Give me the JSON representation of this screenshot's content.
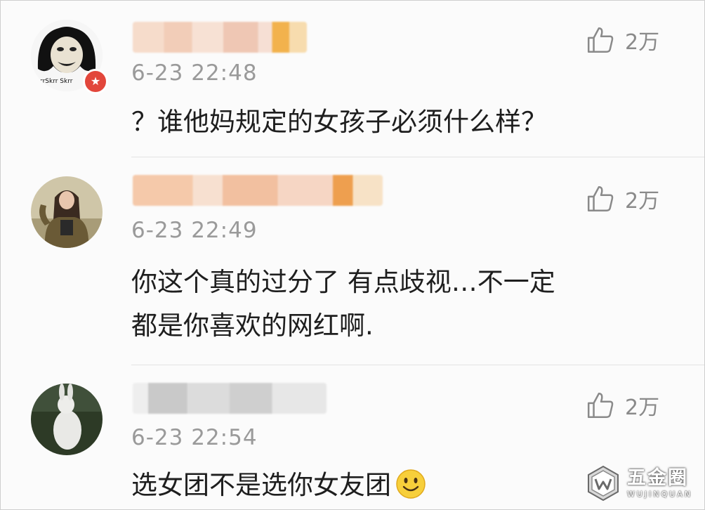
{
  "comments": [
    {
      "time": "6-23 22:48",
      "likes": "2万",
      "text_lines": [
        "？谁他妈规定的女孩子必须什么样？"
      ],
      "avatar_icon": "meme-face-avatar",
      "badge_icon": "vip-badge-icon"
    },
    {
      "time": "6-23 22:49",
      "likes": "2万",
      "text_lines": [
        "你这个真的过分了 有点歧视…不一定",
        "都是你喜欢的网红啊."
      ],
      "avatar_icon": "girl-photo-avatar"
    },
    {
      "time": "6-23 22:54",
      "likes": "2万",
      "text_lines": [
        "选女团不是选你女友团"
      ],
      "avatar_icon": "rabbit-photo-avatar",
      "trailing_emoji": "smiley-emoji-icon"
    }
  ],
  "watermark": {
    "cn": "五金圈",
    "en": "WUJINQUAN"
  },
  "colors": {
    "time_gray": "#9a9a9a",
    "text": "#1e1e1e",
    "like_gray": "#8a8a8a",
    "blur_orange": "#f3c08f",
    "blur_gray": "#cfcfcf",
    "badge_red": "#e2463b"
  }
}
